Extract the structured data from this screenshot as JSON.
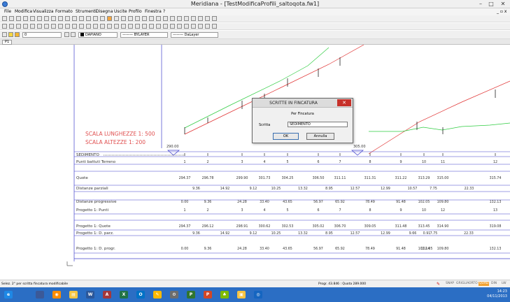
{
  "window": {
    "title": "Meridiana - [TestModificaProfili_saltoqota.fw1]"
  },
  "menu": [
    "File",
    "Modifica",
    "Visualizza",
    "Formato",
    "Strumenti",
    "Disegna",
    "Uscite",
    "Profilo",
    "Finestra",
    "?"
  ],
  "toolbar": {
    "layer_value": "0",
    "color_label": "DAPIANO",
    "linetype_label": "BYLAYER",
    "lineweight_label": "DaLayer"
  },
  "document_tab": "P1",
  "drawing": {
    "scale_long": "SCALA LUNGHEZZE 1: 500",
    "scale_alt": "SCALA ALTEZZE  1: 200",
    "datum_left": "290.00",
    "datum_right": "305.00",
    "rows": [
      {
        "label": "SEDIMENTO",
        "values": []
      },
      {
        "label": "Punti battuti Terreno",
        "values": [
          "1",
          "2",
          "3",
          "4",
          "5",
          "6",
          "7",
          "8",
          "9",
          "10",
          "11",
          "12"
        ]
      },
      {
        "label": "Quote",
        "values": [
          "294.37",
          "296.78",
          "299.90",
          "301.73",
          "304.25",
          "306.50",
          "311.11",
          "311.31",
          "311.22",
          "313.29",
          "315.00",
          "315.74"
        ]
      },
      {
        "label": "Distanze parziali",
        "values": [
          "9.36",
          "14.92",
          "9.12",
          "10.25",
          "13.32",
          "8.95",
          "12.57",
          "12.99",
          "10.57",
          "7.75",
          "22.33"
        ]
      },
      {
        "label": "Distanze progressive",
        "values": [
          "0.00",
          "9.36",
          "24.28",
          "33.40",
          "43.65",
          "56.97",
          "65.92",
          "78.49",
          "91.48",
          "102.05",
          "109.80",
          "132.13"
        ]
      },
      {
        "label": "Progetto 1: Punti",
        "values": [
          "1",
          "2",
          "3",
          "4",
          "5",
          "6",
          "7",
          "8",
          "9",
          "10",
          "12",
          "13"
        ]
      },
      {
        "label": "Progetto 1: Quote",
        "values": [
          "294.37",
          "296.12",
          "298.91",
          "300.62",
          "302.53",
          "305.02",
          "306.70",
          "309.05",
          "311.48",
          "313.45",
          "314.90",
          "319.08"
        ]
      },
      {
        "label": "Progetto 1: D. parz.",
        "values": [
          "9.36",
          "14.92",
          "9.12",
          "10.25",
          "13.32",
          "8.95",
          "12.57",
          "12.99",
          "9.66",
          "0.91",
          "7.75",
          "22.33"
        ]
      },
      {
        "label": "Progetto 1: D. progr.",
        "values": [
          "0.00",
          "9.36",
          "24.28",
          "33.40",
          "43.65",
          "56.97",
          "65.92",
          "78.49",
          "91.48",
          "101.14",
          "102.05",
          "109.80",
          "132.13"
        ]
      }
    ]
  },
  "dialog": {
    "title": "SCRITTE IN FINCATURA",
    "subtitle": "Per Fincatura",
    "field_label": "Scritta",
    "field_value": "SEDIMENTO",
    "ok": "OK",
    "cancel": "Annulla"
  },
  "status": {
    "left": "Selez. 2° per scritta fincatura modificabile",
    "coords": "Progr.  43.846 : Quota  289.000",
    "indicators": [
      "SNAP",
      "GRIGLIA",
      "ORTO",
      "QUAD",
      "DIN",
      "LW"
    ],
    "active_indicator": "QUAD"
  },
  "taskbar": {
    "apps": [
      "ie-icon",
      "metro-icon",
      "firefox-icon",
      "explorer-icon",
      "word-icon",
      "access-icon",
      "excel-icon",
      "outlook-icon",
      "paint-icon",
      "settings-icon",
      "project-icon",
      "powerpoint-icon",
      "games-icon",
      "folder-icon",
      "meridiana-icon"
    ],
    "time": "14:23",
    "date": "04/11/2013"
  },
  "colors": {
    "accent": "#2b6ec4",
    "close": "#c7312a",
    "profile_red": "#e03030",
    "profile_green": "#2ecc40",
    "grid": "#4040cc",
    "scale_text": "#e05050"
  }
}
